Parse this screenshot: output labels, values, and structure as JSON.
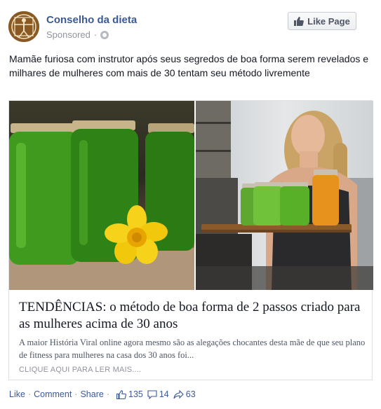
{
  "post": {
    "page_name": "Conselho da dieta",
    "sponsored_label": "Sponsored",
    "sponsored_sep": "·",
    "like_page_label": "Like Page",
    "text": "Mamãe furiosa com instrutor após seus segredos de boa forma serem revelados e milhares de mulheres com mais de 30 tentam seu método livremente"
  },
  "link_card": {
    "title": "TENDÊNCIAS: o método de boa forma de 2 passos criado para as mulheres acima de 30 anos",
    "description": "A maior História Viral online agora mesmo são as alegações chocantes desta mãe de que seu plano de fitness para mulheres na casa dos 30 anos foi...",
    "cta": "CLIQUE AQUI PARA LER MAIS...."
  },
  "actions": {
    "like": "Like",
    "comment": "Comment",
    "share": "Share",
    "sep": "·",
    "likes_count": "135",
    "comments_count": "14",
    "shares_count": "63"
  },
  "colors": {
    "link_blue": "#3b5998",
    "muted_gray": "#90949c",
    "border": "#dddfe2"
  },
  "icons": {
    "avatar": "vitruvian-man-avatar",
    "globe": "globe-icon",
    "thumb": "thumbs-up-icon",
    "comment": "comment-bubble-icon",
    "share": "share-arrow-icon"
  }
}
